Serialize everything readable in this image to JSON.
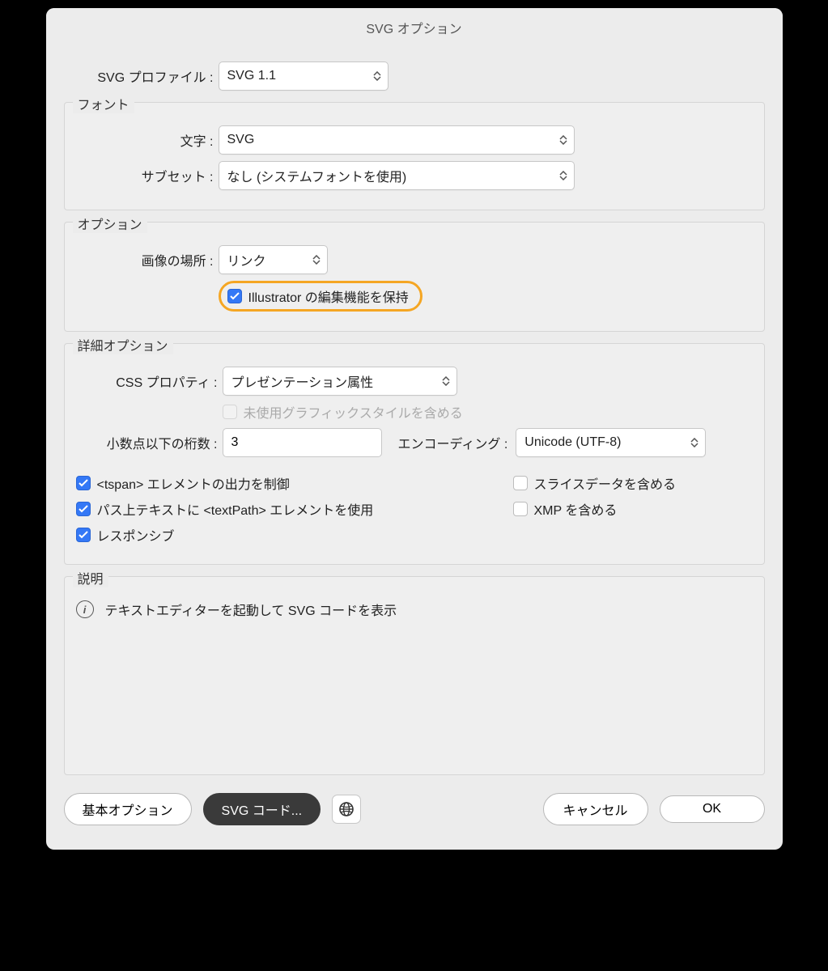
{
  "title": "SVG オプション",
  "svg_profile": {
    "label": "SVG プロファイル :",
    "value": "SVG 1.1"
  },
  "font": {
    "legend": "フォント",
    "type": {
      "label": "文字 :",
      "value": "SVG"
    },
    "subset": {
      "label": "サブセット :",
      "value": "なし (システムフォントを使用)"
    }
  },
  "options": {
    "legend": "オプション",
    "image_location": {
      "label": "画像の場所 :",
      "value": "リンク"
    },
    "preserve_ai": {
      "label": "Illustrator の編集機能を保持",
      "checked": true
    }
  },
  "advanced": {
    "legend": "詳細オプション",
    "css": {
      "label": "CSS プロパティ :",
      "value": "プレゼンテーション属性"
    },
    "unused_styles": {
      "label": "未使用グラフィックスタイルを含める",
      "checked": false,
      "disabled": true
    },
    "decimals": {
      "label": "小数点以下の桁数 :",
      "value": "3"
    },
    "encoding": {
      "label": "エンコーディング :",
      "value": "Unicode (UTF-8)"
    },
    "tspan": {
      "label": "<tspan> エレメントの出力を制御",
      "checked": true
    },
    "textpath": {
      "label": "パス上テキストに <textPath> エレメントを使用",
      "checked": true
    },
    "responsive": {
      "label": "レスポンシブ",
      "checked": true
    },
    "slice": {
      "label": "スライスデータを含める",
      "checked": false
    },
    "xmp": {
      "label": "XMP を含める",
      "checked": false
    }
  },
  "description": {
    "legend": "説明",
    "text": "テキストエディターを起動して SVG コードを表示"
  },
  "buttons": {
    "basic": "基本オプション",
    "svg_code": "SVG コード...",
    "cancel": "キャンセル",
    "ok": "OK"
  }
}
